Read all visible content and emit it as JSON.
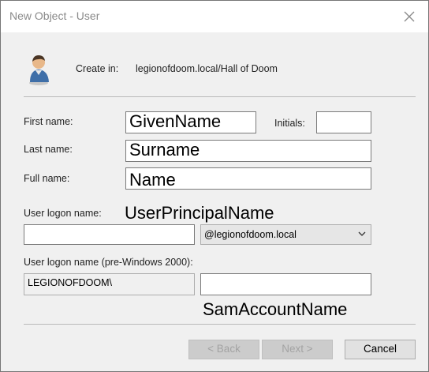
{
  "window": {
    "title": "New Object - User"
  },
  "header": {
    "create_in_label": "Create in:",
    "create_in_value": "legionofdoom.local/Hall of Doom"
  },
  "form": {
    "first_name_label": "First name:",
    "first_name_overlay": "GivenName",
    "initials_label": "Initials:",
    "last_name_label": "Last name:",
    "last_name_overlay": "Surname",
    "full_name_label": "Full name:",
    "full_name_overlay": "Name",
    "logon_label": "User logon name:",
    "logon_overlay": "UserPrincipalName",
    "domain_selected": "@legionofdoom.local",
    "pre2000_label": "User logon name (pre-Windows 2000):",
    "pre2000_domain": "LEGIONOFDOOM\\",
    "pre2000_overlay": "SamAccountName"
  },
  "buttons": {
    "back": "< Back",
    "next": "Next >",
    "cancel": "Cancel"
  },
  "icons": {
    "user": "user-icon",
    "close": "close-icon",
    "dropdown": "chevron-down-icon"
  }
}
